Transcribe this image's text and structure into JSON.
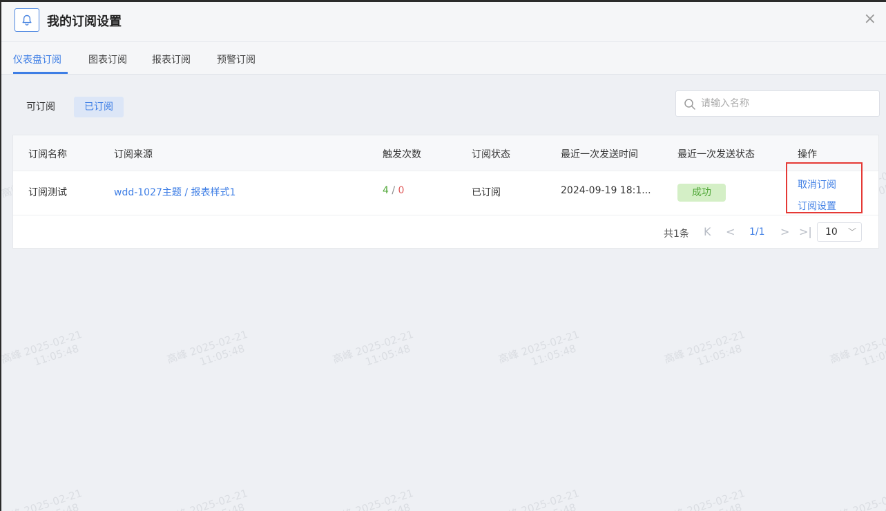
{
  "dialog": {
    "title": "我的订阅设置",
    "close_label": "×"
  },
  "tabs": [
    {
      "label": "仪表盘订阅",
      "active": true
    },
    {
      "label": "图表订阅",
      "active": false
    },
    {
      "label": "报表订阅",
      "active": false
    },
    {
      "label": "预警订阅",
      "active": false
    }
  ],
  "filter": {
    "available_label": "可订阅",
    "subscribed_label": "已订阅",
    "active": "已订阅"
  },
  "search": {
    "placeholder": "请输入名称",
    "value": ""
  },
  "table": {
    "columns": [
      "订阅名称",
      "订阅来源",
      "触发次数",
      "订阅状态",
      "最近一次发送时间",
      "最近一次发送状态",
      "操作"
    ],
    "rows": [
      {
        "name": "订阅测试",
        "source": "wdd-1027主题 / 报表样式1",
        "trigger_success": "4",
        "trigger_sep": " / ",
        "trigger_fail": "0",
        "status": "已订阅",
        "last_send_time": "2024-09-19 18:1...",
        "last_send_status": "成功",
        "actions": [
          "取消订阅",
          "订阅设置"
        ]
      }
    ]
  },
  "pagination": {
    "total": "共1条",
    "page": "1/1",
    "page_size": "10",
    "first_icon": "K",
    "prev_icon": "<",
    "next_icon": ">",
    "last_icon": ">|"
  },
  "watermark": {
    "name": "高峰",
    "date": "2025-02-21",
    "time": "11:05:48"
  },
  "colors": {
    "accent": "#3e7ee5",
    "success": "#52a83a",
    "fail": "#e05a5a",
    "highlight": "#e53935"
  }
}
